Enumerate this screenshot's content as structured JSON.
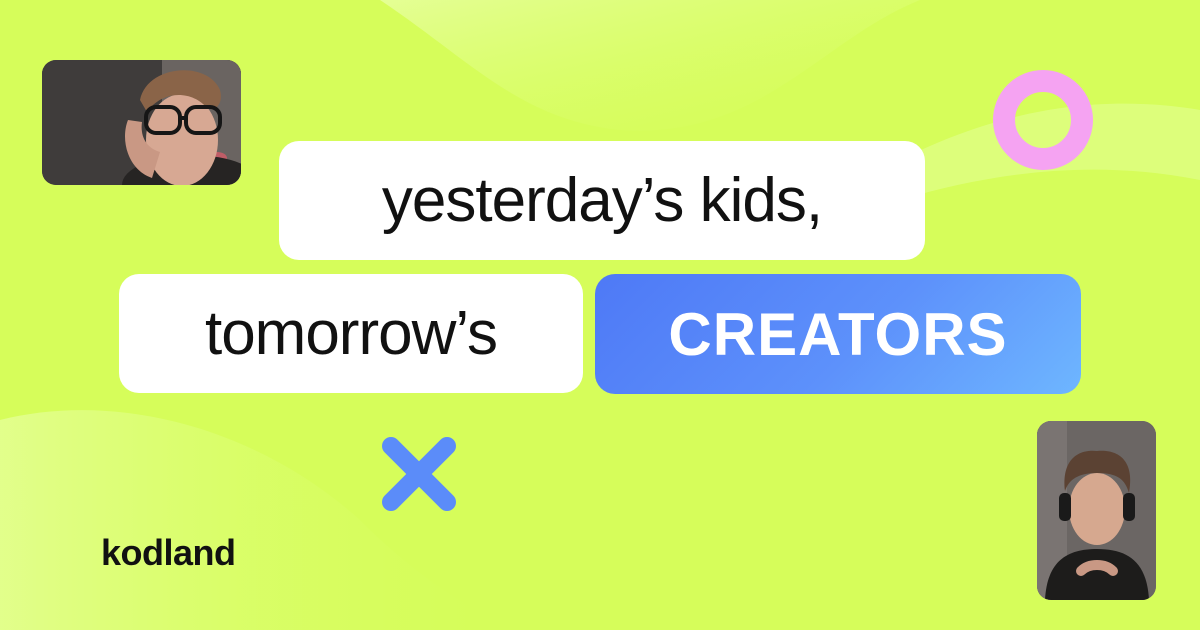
{
  "headline": {
    "line1": "yesterday’s kids,",
    "line2": "tomorrow’s",
    "highlight": "CREATORS"
  },
  "brand": {
    "logo_text": "kodland"
  },
  "photos": [
    {
      "icon": "person-photo-glasses"
    },
    {
      "icon": "person-photo-headphones"
    }
  ],
  "decorations": {
    "ring_icon": "ring-icon",
    "cross_icon": "cross-icon"
  },
  "colors": {
    "background": "#d6fd5a",
    "accent_blue": "#5b8cf9",
    "ring_pink": "#f5a3f2",
    "text_dark": "#111111"
  }
}
